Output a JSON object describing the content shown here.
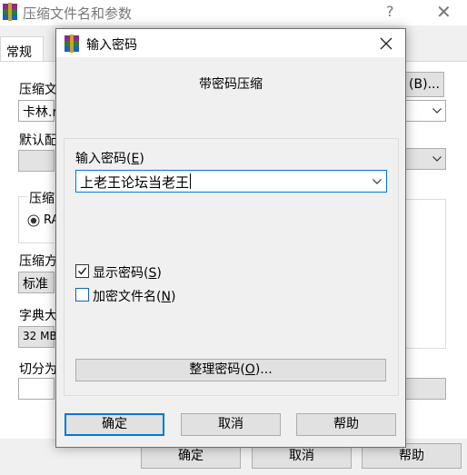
{
  "background_window": {
    "title": "压缩文件名和参数",
    "help_glyph": "?",
    "close_glyph": "✕",
    "tab_label": "常规",
    "label_archive_name": "压缩文",
    "archive_name_value": "卡林.r",
    "browse_button": "(B)...",
    "label_default": "默认配",
    "label_group": "压缩",
    "radio_label": "RA",
    "label_method": "压缩方",
    "method_value": "标准",
    "label_dict": "字典大",
    "dict_value": "32 MB",
    "label_split": "切分为",
    "ok_button": "确定",
    "cancel_button": "取消",
    "help_button": "帮助"
  },
  "dialog": {
    "title": "输入密码",
    "heading": "带密码压缩",
    "password_label": "输入密码",
    "password_label_key": "E",
    "password_value": "上老王论坛当老王",
    "show_password_label": "显示密码",
    "show_password_key": "S",
    "show_password_checked": true,
    "encrypt_names_label": "加密文件名",
    "encrypt_names_key": "N",
    "encrypt_names_checked": false,
    "manage_button": "整理密码",
    "manage_button_key": "O",
    "manage_button_suffix": "...",
    "ok_button": "确定",
    "cancel_button": "取消",
    "help_button": "帮助"
  }
}
